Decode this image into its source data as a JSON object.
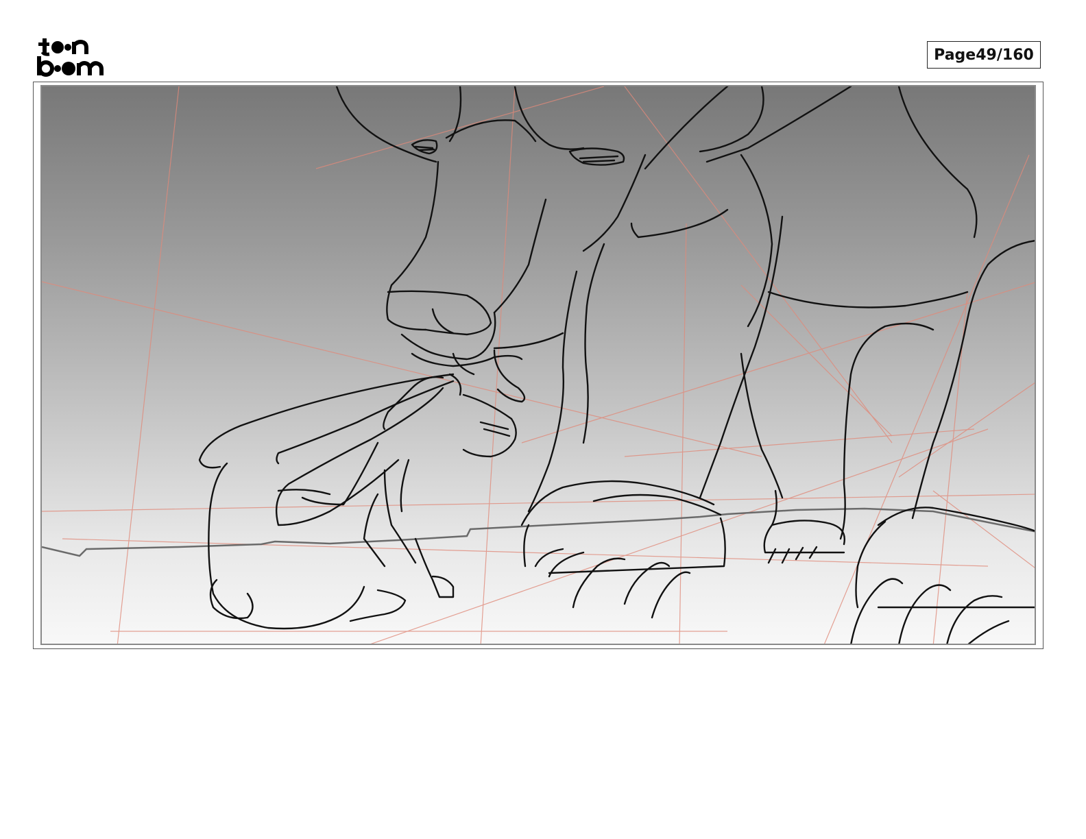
{
  "header": {
    "logo_text": "toonboom",
    "page_label": "Page",
    "page_number": "49/160"
  },
  "panel": {
    "icons": [
      "toon-boom-logo",
      "storyboard-sketch"
    ]
  }
}
